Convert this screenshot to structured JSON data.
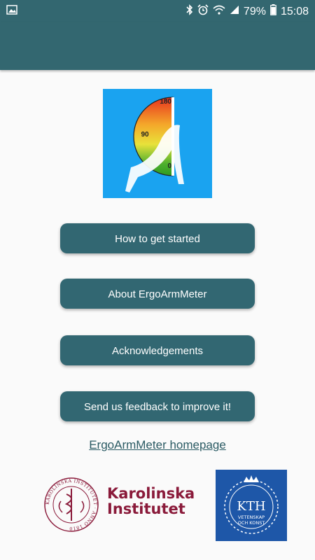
{
  "status_bar": {
    "battery_percent": "79%",
    "time": "15:08",
    "icons": [
      "image-icon",
      "bluetooth-icon",
      "alarm-icon",
      "wifi-icon",
      "signal-icon",
      "battery-icon"
    ]
  },
  "logo": {
    "gauge_labels": [
      "180",
      "90",
      "0"
    ],
    "background_color": "#1aa3f0"
  },
  "buttons": {
    "get_started": "How to get started",
    "about": "About ErgoArmMeter",
    "acknowledgements": "Acknowledgements",
    "feedback": "Send us feedback to improve it!"
  },
  "homepage_link": "ErgoArmMeter homepage",
  "karolinska": {
    "line1": "Karolinska",
    "line2": "Institutet",
    "seal_text": "KAROLINSKA INSTITUTET · ANNO 1810"
  },
  "kth": {
    "name": "KTH",
    "line1": "VETENSKAP",
    "line2": "OCH KONST"
  },
  "colors": {
    "primary": "#336770",
    "button": "#326772",
    "ki_brand": "#8a1a3a",
    "kth_brand": "#1e57a8"
  }
}
